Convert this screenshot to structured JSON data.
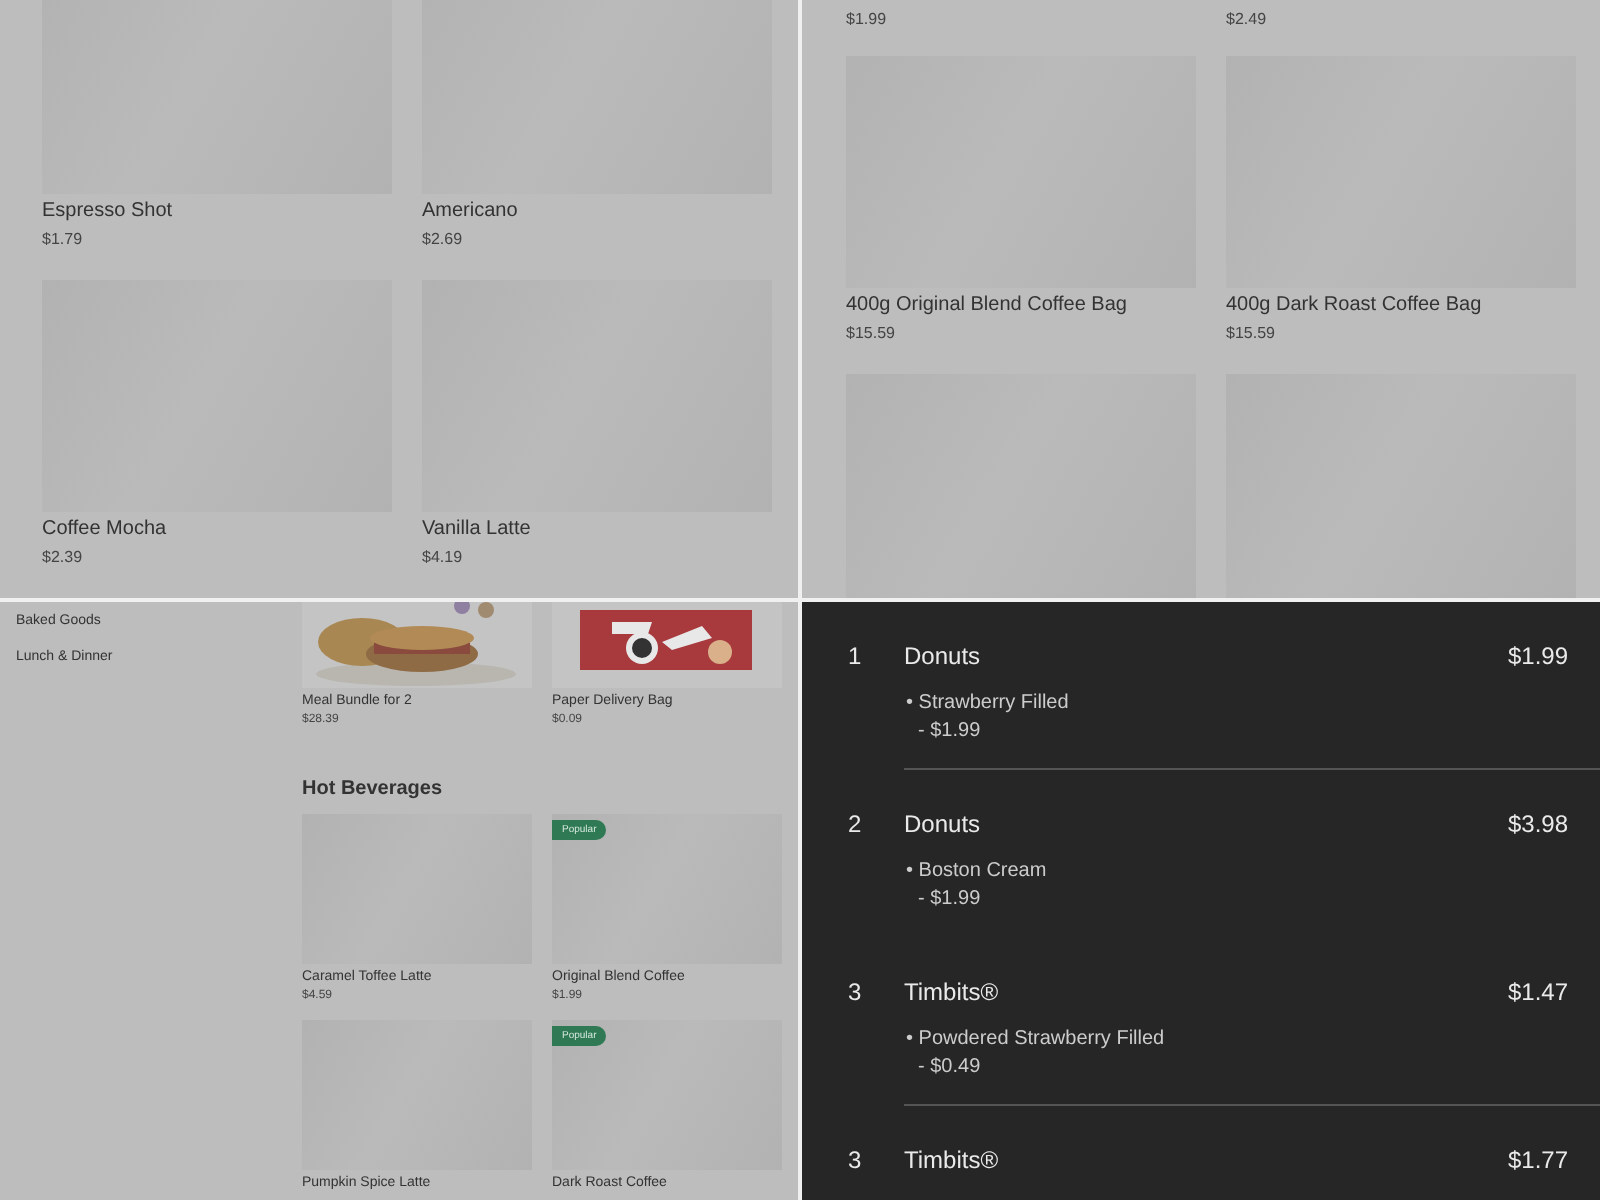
{
  "menu_top_left": {
    "items": [
      {
        "name": "Espresso Shot",
        "price": "$1.79"
      },
      {
        "name": "Americano",
        "price": "$2.69"
      },
      {
        "name": "Coffee Mocha",
        "price": "$2.39"
      },
      {
        "name": "Vanilla Latte",
        "price": "$4.19"
      }
    ]
  },
  "menu_top_right": {
    "cut_prices": [
      "$1.99",
      "$2.49"
    ],
    "items": [
      {
        "name": "400g Original Blend Coffee Bag",
        "price": "$15.59"
      },
      {
        "name": "400g Dark Roast Coffee Bag",
        "price": "$15.59"
      },
      {
        "kind": "placeholder"
      },
      {
        "kind": "placeholder"
      }
    ]
  },
  "menu_bottom_left": {
    "sidebar": {
      "items": [
        {
          "label": "Baked Goods"
        },
        {
          "label": "Lunch & Dinner"
        }
      ]
    },
    "featured": [
      {
        "name": "Meal Bundle for 2",
        "price": "$28.39",
        "kind": "meal"
      },
      {
        "name": "Paper Delivery Bag",
        "price": "$0.09",
        "kind": "bag"
      }
    ],
    "section_title": "Hot Beverages",
    "items": [
      {
        "name": "Caramel Toffee Latte",
        "price": "$4.59"
      },
      {
        "name": "Original Blend Coffee",
        "price": "$1.99",
        "badge": "Popular"
      },
      {
        "name": "Pumpkin Spice Latte"
      },
      {
        "name": "Dark Roast Coffee",
        "badge": "Popular"
      }
    ]
  },
  "order": {
    "lines": [
      {
        "qty": "1",
        "name": "Donuts",
        "price": "$1.99",
        "option": "• Strawberry Filled",
        "option_price": "- $1.99",
        "divider": true
      },
      {
        "qty": "2",
        "name": "Donuts",
        "price": "$3.98",
        "option": "• Boston Cream",
        "option_price": "- $1.99",
        "divider": false
      },
      {
        "qty": "3",
        "name": "Timbits®",
        "price": "$1.47",
        "option": "• Powdered Strawberry Filled",
        "option_price": "- $0.49",
        "divider": true
      },
      {
        "qty": "3",
        "name": "Timbits®",
        "price": "$1.77"
      }
    ]
  }
}
